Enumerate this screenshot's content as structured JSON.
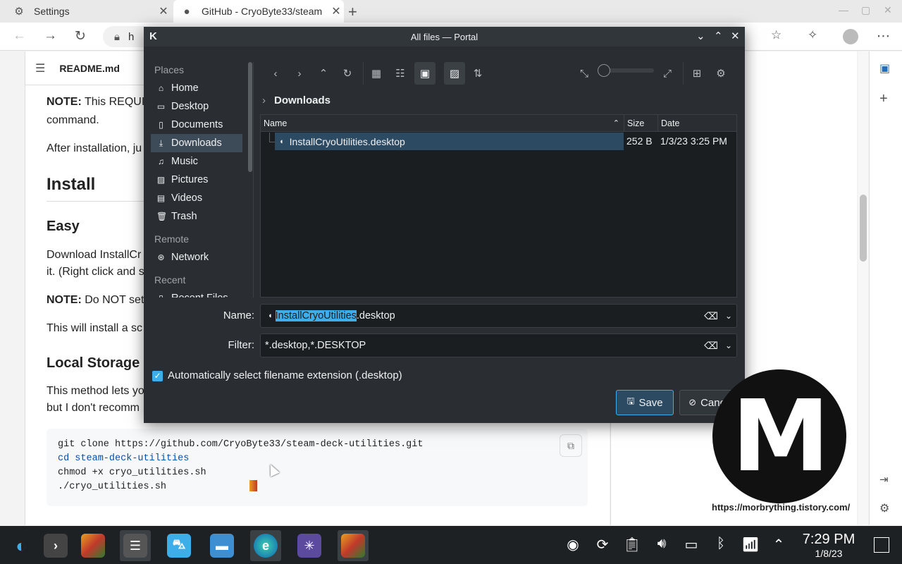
{
  "browser": {
    "tabs": [
      {
        "label": "Settings",
        "icon": "gear-icon"
      },
      {
        "label": "GitHub - CryoByte33/steam",
        "icon": "github-icon"
      }
    ],
    "new_tab": "+",
    "address_prefix": "h"
  },
  "page": {
    "readme_title": "README.md",
    "note1_bold": "NOTE:",
    "note1_text": " This REQUI",
    "note1_line2": "command.",
    "after_install": "After installation, ju",
    "h_install": "Install",
    "h_easy": "Easy",
    "download_line1": "Download InstallCr",
    "download_line2": "it. (Right click and s",
    "note2_bold": "NOTE:",
    "note2_text": " Do NOT set",
    "will_install": "This will install a sc",
    "h_local": "Local Storage",
    "method_line1": "This method lets yo",
    "method_line2": "but I don't recomm",
    "code": [
      "git clone https://github.com/CryoByte33/steam-deck-utilities.git",
      "cd steam-deck-utilities",
      "chmod +x cryo_utilities.sh",
      "./cryo_utilities.sh"
    ]
  },
  "dialog": {
    "title": "All files — Portal",
    "places_header": "Places",
    "places": [
      {
        "label": "Home",
        "icon": "home-icon"
      },
      {
        "label": "Desktop",
        "icon": "desktop-icon"
      },
      {
        "label": "Documents",
        "icon": "documents-icon"
      },
      {
        "label": "Downloads",
        "icon": "downloads-icon"
      },
      {
        "label": "Music",
        "icon": "music-icon"
      },
      {
        "label": "Pictures",
        "icon": "pictures-icon"
      },
      {
        "label": "Videos",
        "icon": "videos-icon"
      },
      {
        "label": "Trash",
        "icon": "trash-icon"
      }
    ],
    "remote_header": "Remote",
    "network": "Network",
    "recent_header": "Recent",
    "recent_item": "Recent Files",
    "breadcrumb": "Downloads",
    "columns": {
      "name": "Name",
      "size": "Size",
      "date": "Date"
    },
    "files": [
      {
        "name": "InstallCryoUtilities.desktop",
        "size": "252 B",
        "date": "1/3/23 3:25 PM"
      }
    ],
    "name_label": "Name:",
    "name_value_selected": "InstallCryoUtilities",
    "name_value_rest": ".desktop",
    "filter_label": "Filter:",
    "filter_value": "*.desktop,*.DESKTOP",
    "auto_ext_label": "Automatically select filename extension (.desktop)",
    "auto_ext_checked": true,
    "save_label": "Save",
    "cancel_label": "Cancel"
  },
  "watermark": {
    "letter": "M",
    "url": "https://morbrything.tistory.com/"
  },
  "taskbar": {
    "time": "7:29 PM",
    "date": "1/8/23"
  },
  "colors": {
    "dialog_bg": "#2a2e32",
    "accent": "#3daee9",
    "selection": "#2d4a63",
    "taskbar_bg": "#1e2124"
  }
}
